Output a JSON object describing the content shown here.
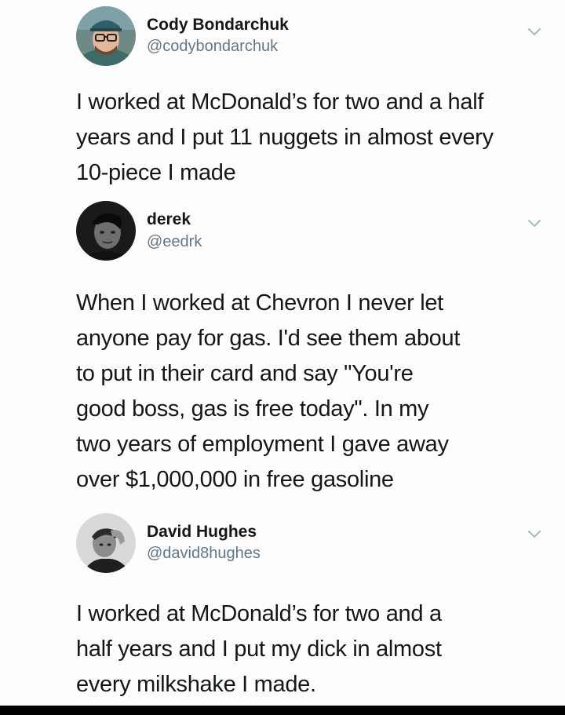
{
  "tweets": [
    {
      "name": "Cody Bondarchuk",
      "handle": "@codybondarchuk",
      "avatar_icon": "person-with-glasses-and-cap-avatar",
      "lines": [
        "I worked at McDonald’s for two and a half",
        "years and I put 11 nuggets in almost every",
        "10-piece I made"
      ]
    },
    {
      "name": "derek",
      "handle": "@eedrk",
      "avatar_icon": "dark-portrait-avatar",
      "lines": [
        "When I worked at Chevron I never let",
        "anyone pay for gas. I'd see them about",
        "to put in their card and say \"You're",
        "good boss, gas is free today\". In my",
        "two years of employment I gave away",
        "over $1,000,000 in free gasoline"
      ]
    },
    {
      "name": "David Hughes",
      "handle": "@david8hughes",
      "avatar_icon": "black-and-white-portrait-avatar",
      "lines": [
        "I worked at McDonald’s for two and a",
        "half years and I put my dick in almost",
        "every milkshake I made."
      ]
    }
  ],
  "icons": {
    "menu": "chevron-down-icon"
  },
  "colors": {
    "text": "#14171a",
    "secondary": "#657786",
    "chevron": "#aab8c2"
  }
}
